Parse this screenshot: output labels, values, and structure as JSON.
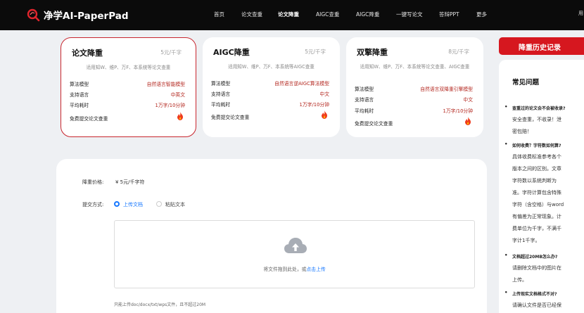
{
  "app": {
    "logo_text": "净学AI-PaperPad"
  },
  "nav": {
    "items": [
      {
        "label": "首页"
      },
      {
        "label": "论文查重"
      },
      {
        "label": "论文降重",
        "active": true
      },
      {
        "label": "AIGC查重"
      },
      {
        "label": "AIGC降重"
      },
      {
        "label": "一键写论文"
      },
      {
        "label": "答辩PPT"
      },
      {
        "label": "更多"
      }
    ],
    "edge_text": "用"
  },
  "cards": [
    {
      "title": "论文降重",
      "price": "5元/千字",
      "desc": "适用知W、维P、万F、本系统等论文查重",
      "selected": true,
      "rows": [
        {
          "key": "算法模型",
          "value": "自然语言智能模型"
        },
        {
          "key": "支持语言",
          "value": "中英文"
        },
        {
          "key": "平均耗时",
          "value": "1万字/10分钟"
        }
      ],
      "free_label": "免费提交论文查重"
    },
    {
      "title": "AIGC降重",
      "price": "5元/千字",
      "desc": "适用知W、维P、万F、本系统等AIGC查重",
      "selected": false,
      "rows": [
        {
          "key": "算法模型",
          "value": "自然语言逆AIGC算法模型"
        },
        {
          "key": "支持语言",
          "value": "中文"
        },
        {
          "key": "平均耗时",
          "value": "1万字/10分钟"
        }
      ],
      "free_label": "免费提交论文查重"
    },
    {
      "title": "双擎降重",
      "price": "8元/千字",
      "desc": "适用知W、维P、万F、本系统等论文查重、AIGC查重",
      "selected": false,
      "rows": [
        {
          "key": "算法模型",
          "value": "自然语言双降重引擎模型"
        },
        {
          "key": "支持语言",
          "value": "中文"
        },
        {
          "key": "平均耗时",
          "value": "1万字/10分钟"
        }
      ],
      "free_label": "免费提交论文查重"
    }
  ],
  "form": {
    "price_label": "降重价格:",
    "price_value": "¥ 5元/千字符",
    "submit_label": "提交方式:",
    "options": [
      {
        "label": "上传文档",
        "selected": true
      },
      {
        "label": "粘贴文本",
        "selected": false
      }
    ],
    "upload_text": "将文件拖到此处，或",
    "upload_link": "点击上传",
    "hint": "只能上传doc/docx/txt/wps文件，且不超过20M"
  },
  "sidebar": {
    "history_button": "降重历史记录",
    "faq_title": "常见问题",
    "faq": [
      {
        "q": "查重过的论文会不会被收录?",
        "a": [
          "安全查重，不收录！泄",
          "密包赔！"
        ]
      },
      {
        "q": "如何收费？字符数如何算?",
        "a": [
          "具体收费标准参考各个",
          "版本之间的区别。文章",
          "字符数以系统判断为",
          "准。字符计算包含特殊",
          "字符（含空格）与word",
          "有偏差为正常现象。计",
          "费单位为千字，不满千",
          "字计1千字。"
        ]
      },
      {
        "q": "文档超过20MB怎么办?",
        "a": [
          "请删除文档中的图片在",
          "上传。"
        ]
      },
      {
        "q": "上传现实文档格式不对?",
        "a": [
          "请确认文件是否已经保"
        ]
      }
    ]
  },
  "colors": {
    "brand_red": "#d6171f",
    "value_red": "#b3261e",
    "link_blue": "#1677ff",
    "topbar": "#0b0b0b"
  }
}
